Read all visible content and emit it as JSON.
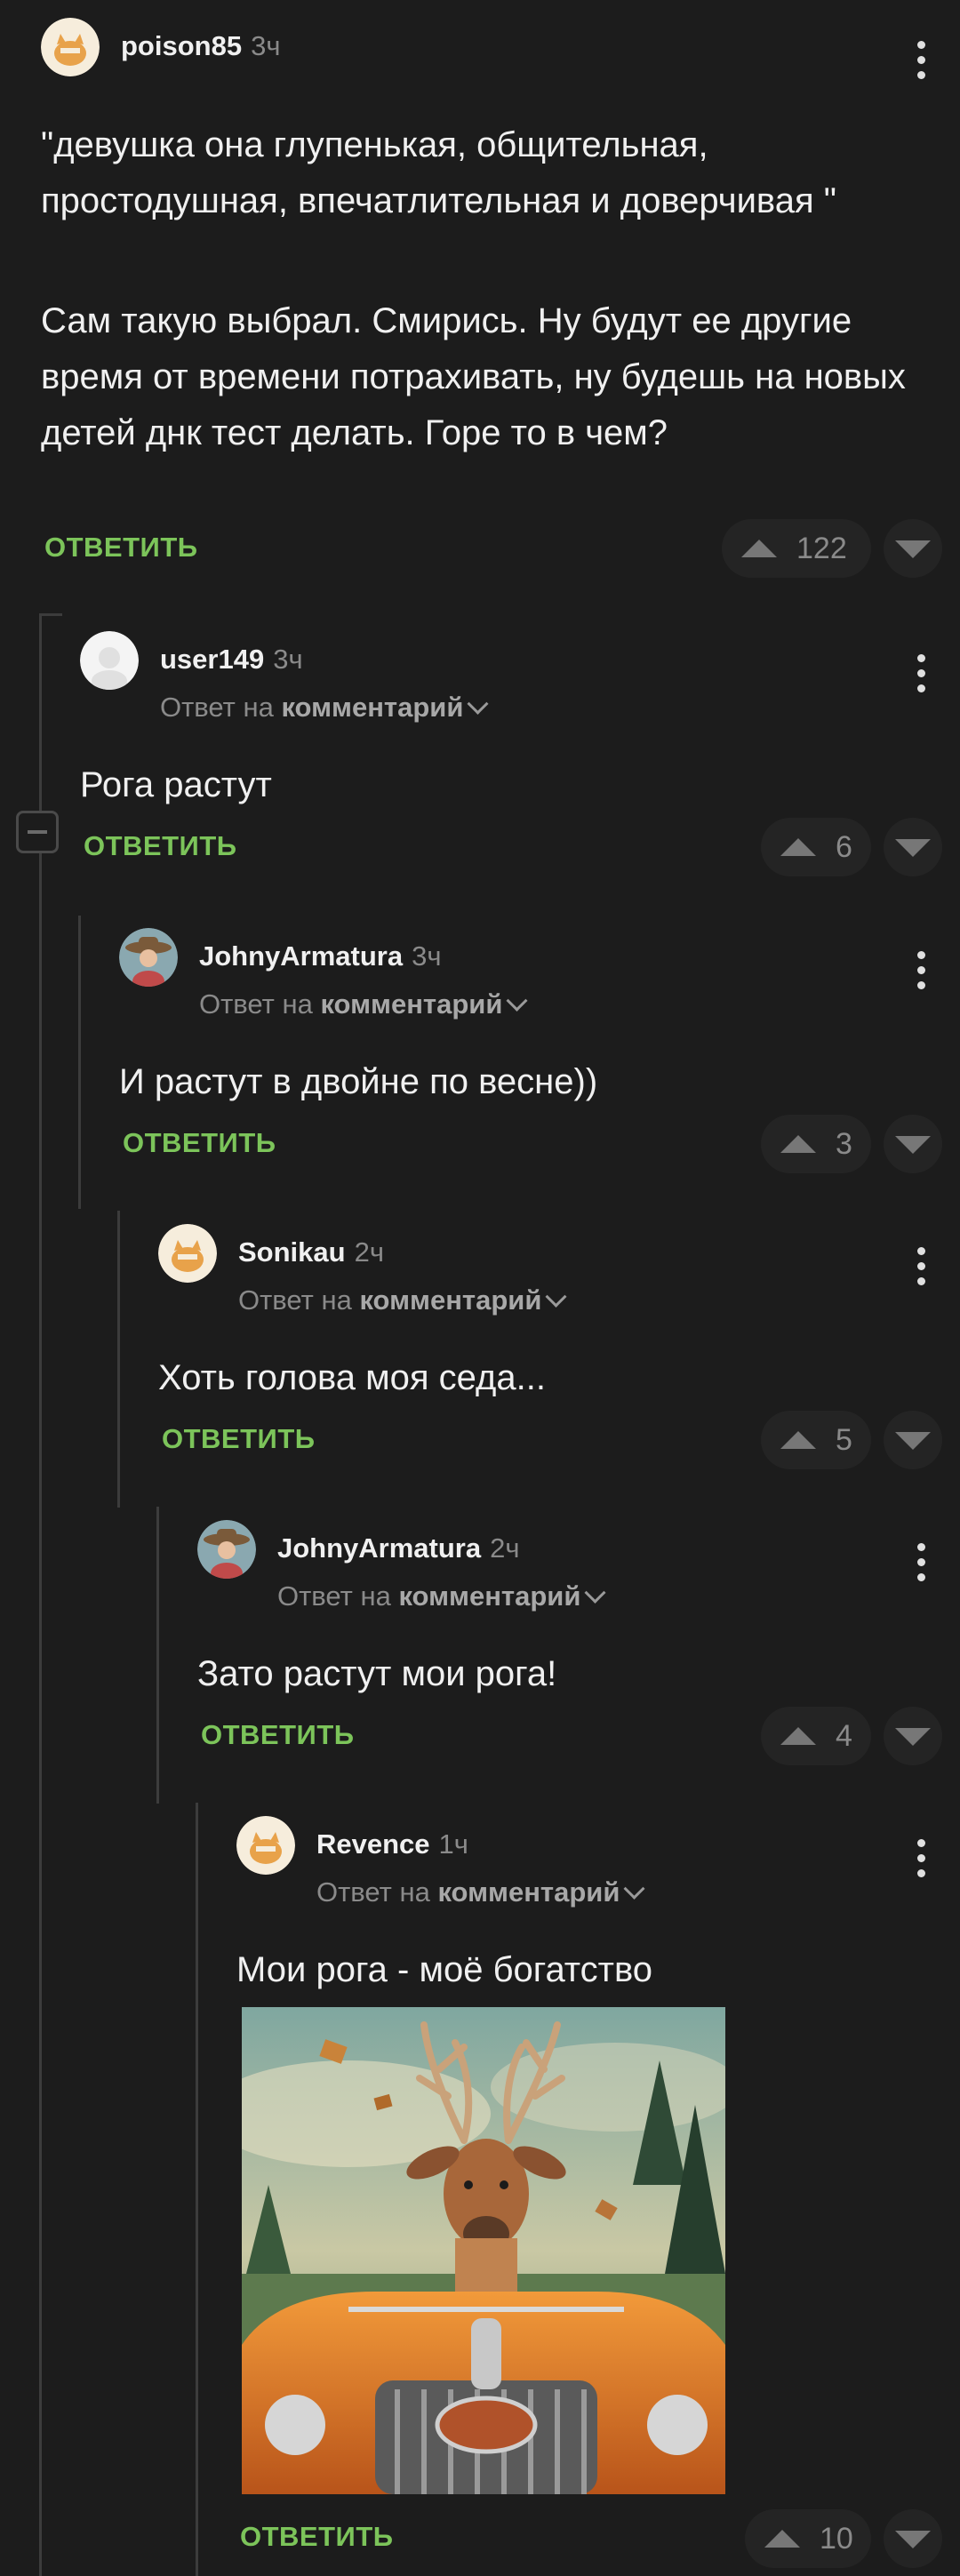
{
  "comments": [
    {
      "author": "poison85",
      "time": "3ч",
      "paragraphs": [
        "\"девушка она глупенькая, общительная, простодушная, впечатлительная и доверчивая \"",
        "Сам такую выбрал. Смирись. Ну будут ее другие время от времени потрахивать, ну будешь на новых детей днк тест делать. Горе то в чем?"
      ],
      "reply_label": "ОТВЕТИТЬ",
      "score": "122",
      "avatar": "cat-avatar"
    },
    {
      "author": "user149",
      "time": "3ч",
      "reply_prefix": "Ответ на",
      "reply_target": "комментарий",
      "text": "Рога растут",
      "reply_label": "ОТВЕТИТЬ",
      "score": "6",
      "avatar": "user-avatar"
    },
    {
      "author": "JohnyArmatura",
      "time": "3ч",
      "reply_prefix": "Ответ на",
      "reply_target": "комментарий",
      "text": "И растут в двойне по весне))",
      "reply_label": "ОТВЕТИТЬ",
      "score": "3",
      "avatar": "cowboy-avatar"
    },
    {
      "author": "Sonikau",
      "time": "2ч",
      "reply_prefix": "Ответ на",
      "reply_target": "комментарий",
      "text": "Хоть голова моя седа...",
      "reply_label": "ОТВЕТИТЬ",
      "score": "5",
      "avatar": "cat-avatar"
    },
    {
      "author": "JohnyArmatura",
      "time": "2ч",
      "reply_prefix": "Ответ на",
      "reply_target": "комментарий",
      "text": "Зато растут мои рога!",
      "reply_label": "ОТВЕТИТЬ",
      "score": "4",
      "avatar": "cowboy-avatar"
    },
    {
      "author": "Revence",
      "time": "1ч",
      "reply_prefix": "Ответ на",
      "reply_target": "комментарий",
      "text": "Мои рога - моё богатство",
      "image": "deer-driving-car-image",
      "reply_label": "ОТВЕТИТЬ",
      "score": "10",
      "avatar": "cat-avatar"
    }
  ],
  "colors": {
    "background": "#1c1c1c",
    "reply_green": "#7cc45a",
    "muted": "#8a8a8a"
  }
}
